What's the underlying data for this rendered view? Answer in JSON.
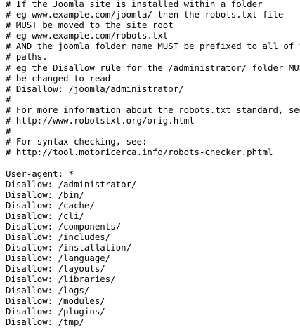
{
  "document": {
    "lines": [
      "# If the Joomla site is installed within a folder",
      "# eg www.example.com/joomla/ then the robots.txt file",
      "# MUST be moved to the site root",
      "# eg www.example.com/robots.txt",
      "# AND the joomla folder name MUST be prefixed to all of the",
      "# paths.",
      "# eg the Disallow rule for the /administrator/ folder MUST",
      "# be changed to read",
      "# Disallow: /joomla/administrator/",
      "#",
      "# For more information about the robots.txt standard, see:",
      "# http://www.robotstxt.org/orig.html",
      "#",
      "# For syntax checking, see:",
      "# http://tool.motoricerca.info/robots-checker.phtml",
      "",
      "User-agent: *",
      "Disallow: /administrator/",
      "Disallow: /bin/",
      "Disallow: /cache/",
      "Disallow: /cli/",
      "Disallow: /components/",
      "Disallow: /includes/",
      "Disallow: /installation/",
      "Disallow: /language/",
      "Disallow: /layouts/",
      "Disallow: /libraries/",
      "Disallow: /logs/",
      "Disallow: /modules/",
      "Disallow: /plugins/",
      "Disallow: /tmp/"
    ]
  }
}
